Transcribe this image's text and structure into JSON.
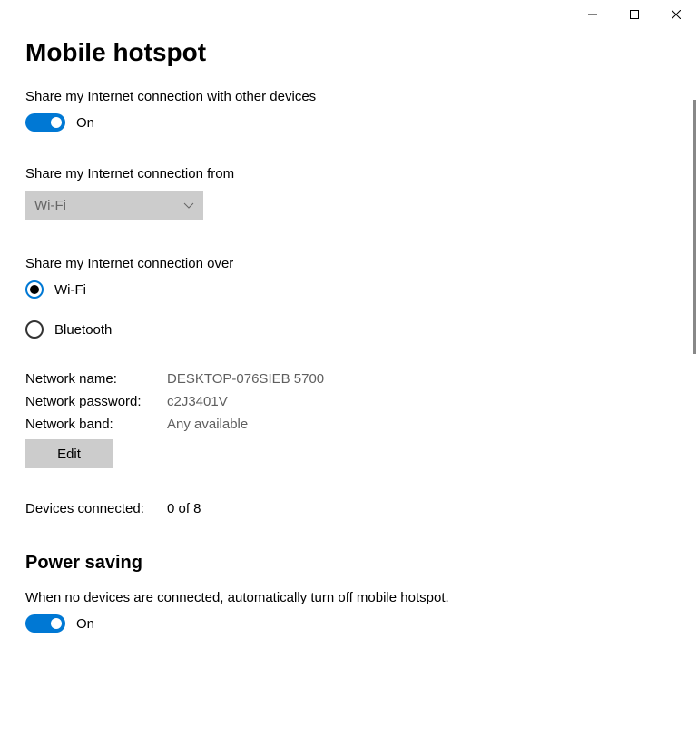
{
  "titlebar": {
    "minimize": "minimize",
    "maximize": "maximize",
    "close": "close"
  },
  "page": {
    "title": "Mobile hotspot"
  },
  "shareConnection": {
    "label": "Share my Internet connection with other devices",
    "state": "On"
  },
  "shareFrom": {
    "label": "Share my Internet connection from",
    "selected": "Wi-Fi"
  },
  "shareOver": {
    "label": "Share my Internet connection over",
    "options": [
      {
        "label": "Wi-Fi",
        "selected": true
      },
      {
        "label": "Bluetooth",
        "selected": false
      }
    ]
  },
  "networkInfo": {
    "nameLabel": "Network name:",
    "nameValue": "DESKTOP-076SIEB 5700",
    "passwordLabel": "Network password:",
    "passwordValue": "c2J3401V",
    "bandLabel": "Network band:",
    "bandValue": "Any available",
    "editButton": "Edit"
  },
  "devices": {
    "label": "Devices connected:",
    "value": "0 of 8"
  },
  "powerSaving": {
    "heading": "Power saving",
    "description": "When no devices are connected, automatically turn off mobile hotspot.",
    "state": "On"
  }
}
